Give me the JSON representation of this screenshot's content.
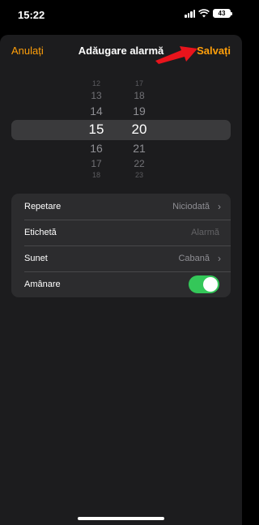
{
  "status_bar": {
    "time": "15:22",
    "battery": "43",
    "icons": [
      "signal-icon",
      "wifi-icon",
      "battery-icon"
    ]
  },
  "nav": {
    "cancel_label": "Anulați",
    "title": "Adăugare alarmă",
    "save_label": "Salvați"
  },
  "picker": {
    "hours": [
      "12",
      "13",
      "14",
      "15",
      "16",
      "17",
      "18"
    ],
    "minutes": [
      "17",
      "18",
      "19",
      "20",
      "21",
      "22",
      "23"
    ],
    "selected_hour": "15",
    "selected_minute": "20"
  },
  "settings": {
    "repeat": {
      "label": "Repetare",
      "value": "Niciodată"
    },
    "label": {
      "label": "Etichetă",
      "placeholder": "Alarmă"
    },
    "sound": {
      "label": "Sunet",
      "value": "Cabană"
    },
    "snooze": {
      "label": "Amânare",
      "enabled": true
    }
  },
  "colors": {
    "accent": "#ff9f0a",
    "toggle_on": "#34c759",
    "annotation_arrow": "#e8141c"
  }
}
